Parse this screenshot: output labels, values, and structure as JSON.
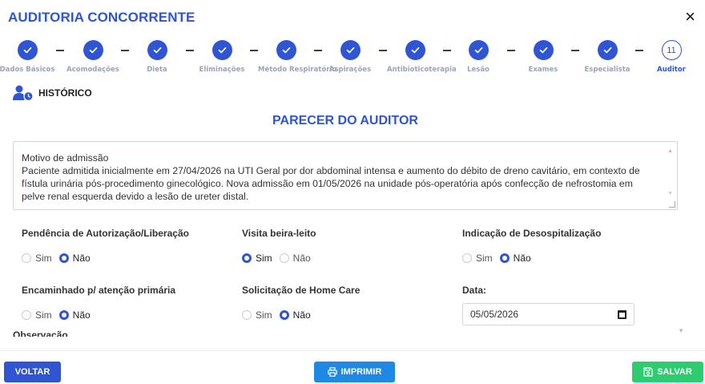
{
  "modal": {
    "title": "AUDITORIA CONCORRENTE",
    "close_label": "×"
  },
  "stepper": {
    "steps": [
      {
        "label": "Dados Básicos",
        "done": true
      },
      {
        "label": "Acomodações",
        "done": true
      },
      {
        "label": "Dieta",
        "done": true
      },
      {
        "label": "Eliminações",
        "done": true
      },
      {
        "label": "Método Respiratório",
        "done": true
      },
      {
        "label": "Aspirações",
        "done": true
      },
      {
        "label": "Antibioticoterapia",
        "done": true
      },
      {
        "label": "Lesão",
        "done": true
      },
      {
        "label": "Exames",
        "done": true
      },
      {
        "label": "Especialista",
        "done": true
      },
      {
        "label": "Auditor",
        "done": false,
        "number": "11"
      }
    ]
  },
  "historico": {
    "label": "HISTÓRICO",
    "icon": "user-clock-icon"
  },
  "section": {
    "title": "PARECER DO AUDITOR"
  },
  "parecer": {
    "line1": "Motivo de admissão",
    "line2": "Paciente admitida inicialmente em 27/04/2026 na UTI Geral por dor abdominal intensa e aumento do débito de dreno cavitário, em contexto de fístula urinária pós-procedimento ginecológico. Nova admissão em 01/05/2026 na unidade pós-operatória após confecção de nefrostomia em pelve renal esquerda devido a lesão de ureter distal."
  },
  "fields": {
    "pendencia": {
      "label": "Pendência de Autorização/Liberação",
      "sim": "Sim",
      "nao": "Não",
      "selected": "nao"
    },
    "visita": {
      "label": "Visita beira-leito",
      "sim": "Sim",
      "nao": "Não",
      "selected": "sim"
    },
    "desospitalizacao": {
      "label": "Indicação de Desospitalização",
      "sim": "Sim",
      "nao": "Não",
      "selected": "nao"
    },
    "encaminhado": {
      "label": "Encaminhado p/ atenção primária",
      "sim": "Sim",
      "nao": "Não",
      "selected": "nao"
    },
    "homecare": {
      "label": "Solicitação de Home Care",
      "sim": "Sim",
      "nao": "Não",
      "selected": "nao"
    },
    "data": {
      "label": "Data:",
      "value": "05/05/2026"
    }
  },
  "observacao": {
    "label": "Observação"
  },
  "footer": {
    "voltar": "VOLTAR",
    "imprimir": "IMPRIMIR",
    "salvar": "SALVAR"
  },
  "colors": {
    "primary": "#2f55d4",
    "print": "#1e88e5",
    "save": "#2ecc71"
  }
}
